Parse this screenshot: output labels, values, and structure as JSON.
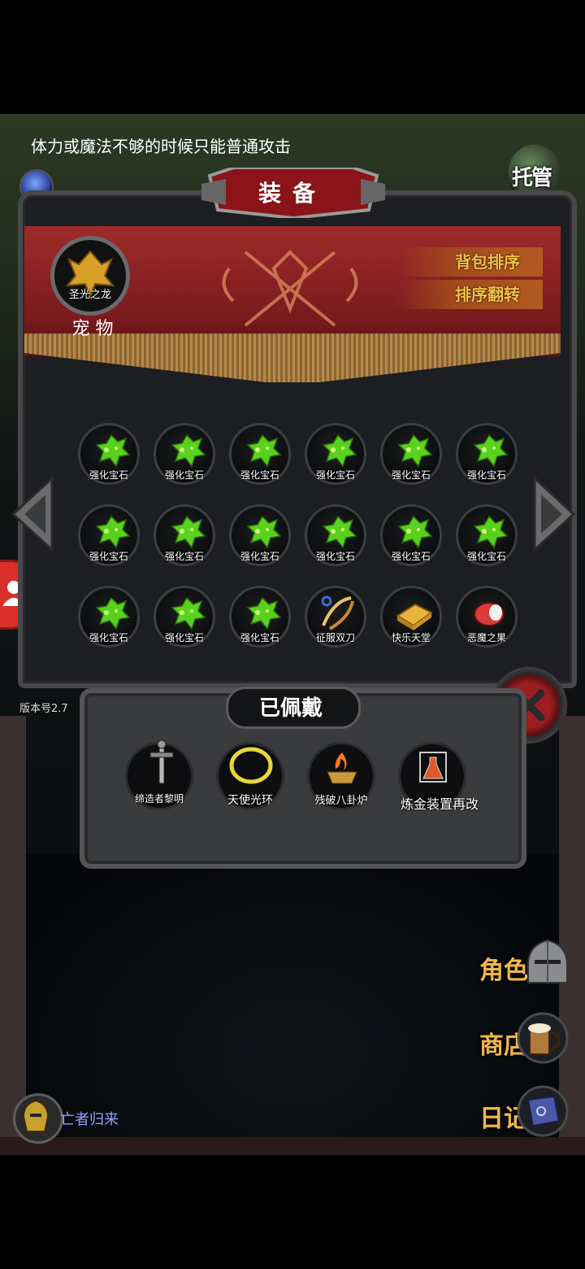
{
  "hud": {
    "tip_text": "体力或魔法不够的时候只能普通攻击",
    "auto_label": "托管",
    "version_label": "版本号2.7"
  },
  "equipment_panel": {
    "title": "装备",
    "sort_button": "背包排序",
    "reverse_sort_button": "排序翻转",
    "pet": {
      "name": "圣光之龙",
      "label": "宠 物"
    },
    "inventory": [
      {
        "name": "强化宝石",
        "icon": "green-gem-icon"
      },
      {
        "name": "强化宝石",
        "icon": "green-gem-icon"
      },
      {
        "name": "强化宝石",
        "icon": "green-gem-icon"
      },
      {
        "name": "强化宝石",
        "icon": "green-gem-icon"
      },
      {
        "name": "强化宝石",
        "icon": "green-gem-icon"
      },
      {
        "name": "强化宝石",
        "icon": "green-gem-icon"
      },
      {
        "name": "强化宝石",
        "icon": "green-gem-icon"
      },
      {
        "name": "强化宝石",
        "icon": "green-gem-icon"
      },
      {
        "name": "强化宝石",
        "icon": "green-gem-icon"
      },
      {
        "name": "强化宝石",
        "icon": "green-gem-icon"
      },
      {
        "name": "强化宝石",
        "icon": "green-gem-icon"
      },
      {
        "name": "强化宝石",
        "icon": "green-gem-icon"
      },
      {
        "name": "强化宝石",
        "icon": "green-gem-icon"
      },
      {
        "name": "强化宝石",
        "icon": "green-gem-icon"
      },
      {
        "name": "强化宝石",
        "icon": "green-gem-icon"
      },
      {
        "name": "征服双刀",
        "icon": "twin-blades-icon"
      },
      {
        "name": "快乐天堂",
        "icon": "gold-book-icon"
      },
      {
        "name": "恶魔之果",
        "icon": "demon-fruit-icon"
      }
    ]
  },
  "equipped": {
    "title": "已佩戴",
    "items": [
      {
        "name": "缔造者黎明",
        "icon": "sword-icon"
      },
      {
        "name": "天使光环",
        "icon": "halo-icon"
      },
      {
        "name": "残破八卦炉",
        "icon": "furnace-icon"
      },
      {
        "name": "炼金装置再改",
        "icon": "alchemy-flask-icon"
      }
    ]
  },
  "side_nav": [
    {
      "label": "角色",
      "icon": "knight-helmet-icon"
    },
    {
      "label": "商店",
      "icon": "beer-mug-icon"
    },
    {
      "label": "日记",
      "icon": "journal-icon"
    }
  ],
  "boss": {
    "label": "亡者归来"
  },
  "colors": {
    "accent_gold": "#f2b54a",
    "banner_red": "#9e2b2b",
    "gem_green": "#5bd11f"
  }
}
